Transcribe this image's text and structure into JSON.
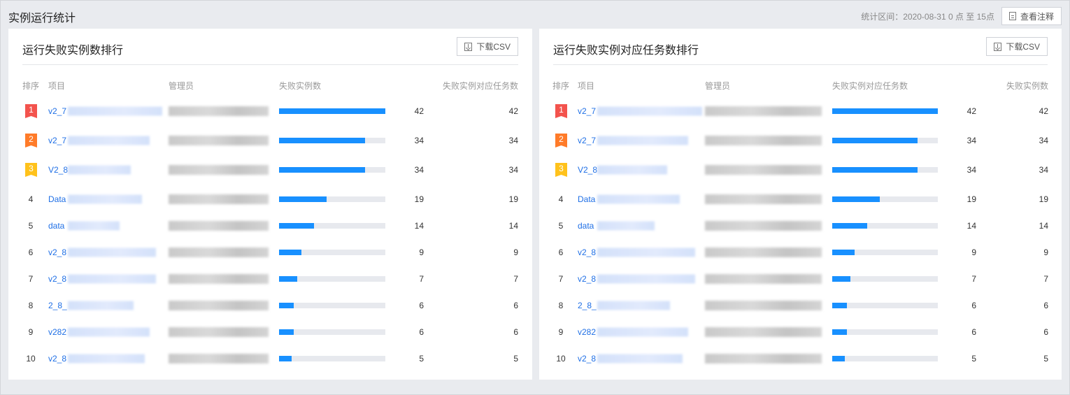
{
  "page": {
    "title": "实例运行统计",
    "stat_range": "统计区间：2020-08-31 0 点 至 15点",
    "annotation_btn": "查看注释"
  },
  "colors": {
    "accent": "#1890ff",
    "link": "#1f6fe6",
    "rank1": "#f3534d",
    "rank2": "#ff7b29",
    "rank3": "#ffc21b"
  },
  "left_panel": {
    "title": "运行失败实例数排行",
    "download_btn": "下载CSV",
    "headers": {
      "rank": "排序",
      "project": "项目",
      "admin": "管理员",
      "metric": "失败实例数",
      "extra": "失败实例对应任务数"
    },
    "rows": [
      {
        "rank": "1",
        "project": "v2_7",
        "metric": 42,
        "extra": "42",
        "ratio": 1.0
      },
      {
        "rank": "2",
        "project": "v2_7",
        "metric": 34,
        "extra": "34",
        "ratio": 0.81
      },
      {
        "rank": "3",
        "project": "V2_8",
        "metric": 34,
        "extra": "34",
        "ratio": 0.81
      },
      {
        "rank": "4",
        "project": "Data",
        "metric": 19,
        "extra": "19",
        "ratio": 0.45
      },
      {
        "rank": "5",
        "project": "data",
        "metric": 14,
        "extra": "14",
        "ratio": 0.33
      },
      {
        "rank": "6",
        "project": "v2_8",
        "metric": 9,
        "extra": "9",
        "ratio": 0.21
      },
      {
        "rank": "7",
        "project": "v2_8",
        "metric": 7,
        "extra": "7",
        "ratio": 0.17
      },
      {
        "rank": "8",
        "project": "2_8_",
        "metric": 6,
        "extra": "6",
        "ratio": 0.14
      },
      {
        "rank": "9",
        "project": "v282",
        "metric": 6,
        "extra": "6",
        "ratio": 0.14
      },
      {
        "rank": "10",
        "project": "v2_8",
        "metric": 5,
        "extra": "5",
        "ratio": 0.12
      }
    ]
  },
  "right_panel": {
    "title": "运行失败实例对应任务数排行",
    "download_btn": "下载CSV",
    "headers": {
      "rank": "排序",
      "project": "项目",
      "admin": "管理员",
      "metric": "失败实例对应任务数",
      "extra": "失败实例数"
    },
    "rows": [
      {
        "rank": "1",
        "project": "v2_7",
        "metric": 42,
        "extra": "42",
        "ratio": 1.0
      },
      {
        "rank": "2",
        "project": "v2_7",
        "metric": 34,
        "extra": "34",
        "ratio": 0.81
      },
      {
        "rank": "3",
        "project": "V2_8",
        "metric": 34,
        "extra": "34",
        "ratio": 0.81
      },
      {
        "rank": "4",
        "project": "Data",
        "metric": 19,
        "extra": "19",
        "ratio": 0.45
      },
      {
        "rank": "5",
        "project": "data",
        "metric": 14,
        "extra": "14",
        "ratio": 0.33
      },
      {
        "rank": "6",
        "project": "v2_8",
        "metric": 9,
        "extra": "9",
        "ratio": 0.21
      },
      {
        "rank": "7",
        "project": "v2_8",
        "metric": 7,
        "extra": "7",
        "ratio": 0.17
      },
      {
        "rank": "8",
        "project": "2_8_",
        "metric": 6,
        "extra": "6",
        "ratio": 0.14
      },
      {
        "rank": "9",
        "project": "v282",
        "metric": 6,
        "extra": "6",
        "ratio": 0.14
      },
      {
        "rank": "10",
        "project": "v2_8",
        "metric": 5,
        "extra": "5",
        "ratio": 0.12
      }
    ]
  }
}
